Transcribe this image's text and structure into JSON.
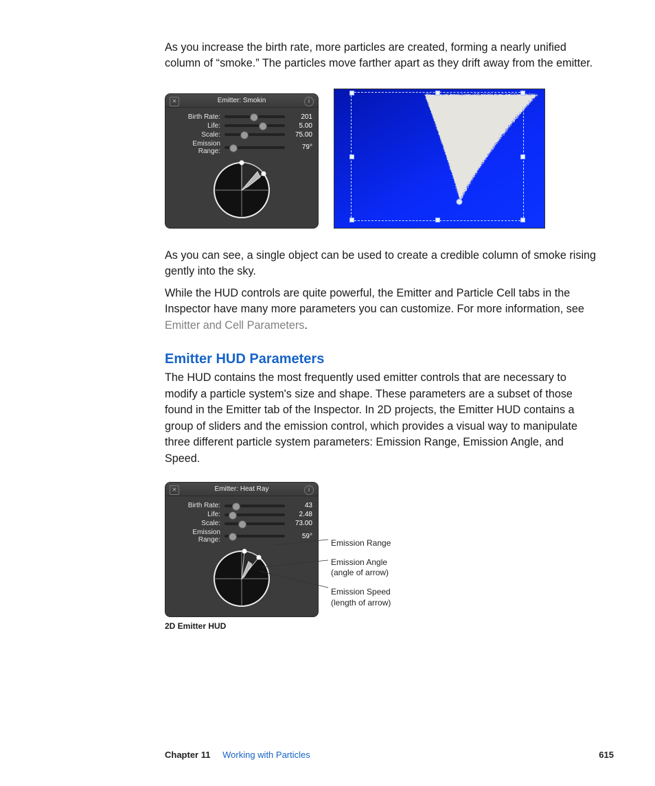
{
  "para1": "As you increase the birth rate, more particles are created, forming a nearly unified column of “smoke.” The particles move farther apart as they drift away from the emitter.",
  "hud1": {
    "title": "Emitter: Smokin",
    "rows": [
      {
        "label": "Birth Rate:",
        "value": "201",
        "pos": 48
      },
      {
        "label": "Life:",
        "value": "5.00",
        "pos": 62
      },
      {
        "label": "Scale:",
        "value": "75.00",
        "pos": 32
      },
      {
        "label": "Emission Range:",
        "value": "79°",
        "pos": 14
      }
    ]
  },
  "para2": "As you can see, a single object can be used to create a credible column of smoke rising gently into the sky.",
  "para3a": "While the HUD controls are quite powerful, the Emitter and Particle Cell tabs in the Inspector have many more parameters you can customize. For more information, see ",
  "link1": "Emitter and Cell Parameters",
  "para3b": ".",
  "heading": "Emitter HUD Parameters",
  "para4": "The HUD contains the most frequently used emitter controls that are necessary to modify a particle system's size and shape. These parameters are a subset of those found in the Emitter tab of the Inspector. In 2D projects, the Emitter HUD contains a group of sliders and the emission control, which provides a visual way to manipulate three different particle system parameters: Emission Range, Emission Angle, and Speed.",
  "hud2": {
    "title": "Emitter: Heat Ray",
    "rows": [
      {
        "label": "Birth Rate:",
        "value": "43",
        "pos": 18
      },
      {
        "label": "Life:",
        "value": "2.48",
        "pos": 12
      },
      {
        "label": "Scale:",
        "value": "73.00",
        "pos": 28
      },
      {
        "label": "Emission Range:",
        "value": "59°",
        "pos": 12
      }
    ]
  },
  "callouts": {
    "c1": "Emission Range",
    "c2a": "Emission Angle",
    "c2b": "(angle of arrow)",
    "c3a": "Emission Speed",
    "c3b": "(length of arrow)"
  },
  "caption": "2D Emitter HUD",
  "footer": {
    "chapter_label": "Chapter 11",
    "chapter_title": "Working with Particles",
    "page": "615"
  }
}
